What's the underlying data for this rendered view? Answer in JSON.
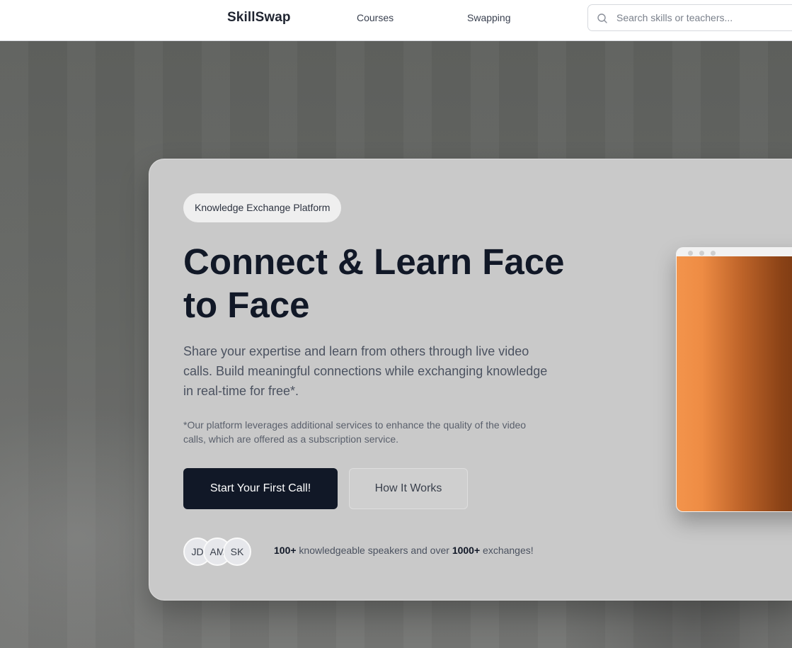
{
  "nav": {
    "brand": "SkillSwap",
    "links": [
      "Courses",
      "Swapping"
    ],
    "search": {
      "placeholder": "Search skills or teachers..."
    }
  },
  "hero": {
    "badge": "Knowledge Exchange Platform",
    "headline": "Connect & Learn Face to Face",
    "lede": "Share your expertise and learn from others through live video calls. Build meaningful connections while exchanging knowledge in real-time for free*.",
    "footnote": "*Our platform leverages additional services to enhance the quality of the video calls, which are offered as a subscription service.",
    "primary_cta": "Start Your First Call!",
    "secondary_cta": "How It Works",
    "avatars": [
      "JD",
      "AM",
      "SK"
    ],
    "stats": {
      "speakers_count": "100+",
      "speakers_text": " knowledgeable speakers and over ",
      "exchanges_count": "1000+",
      "exchanges_text": " exchanges!"
    }
  },
  "icons": {
    "search": "search-icon"
  },
  "colors": {
    "primary_button": "#111827",
    "headline": "#111827",
    "card_background": "#c9c9c9",
    "video_gradient_start": "#f3944c",
    "video_gradient_end": "#6e3310"
  }
}
